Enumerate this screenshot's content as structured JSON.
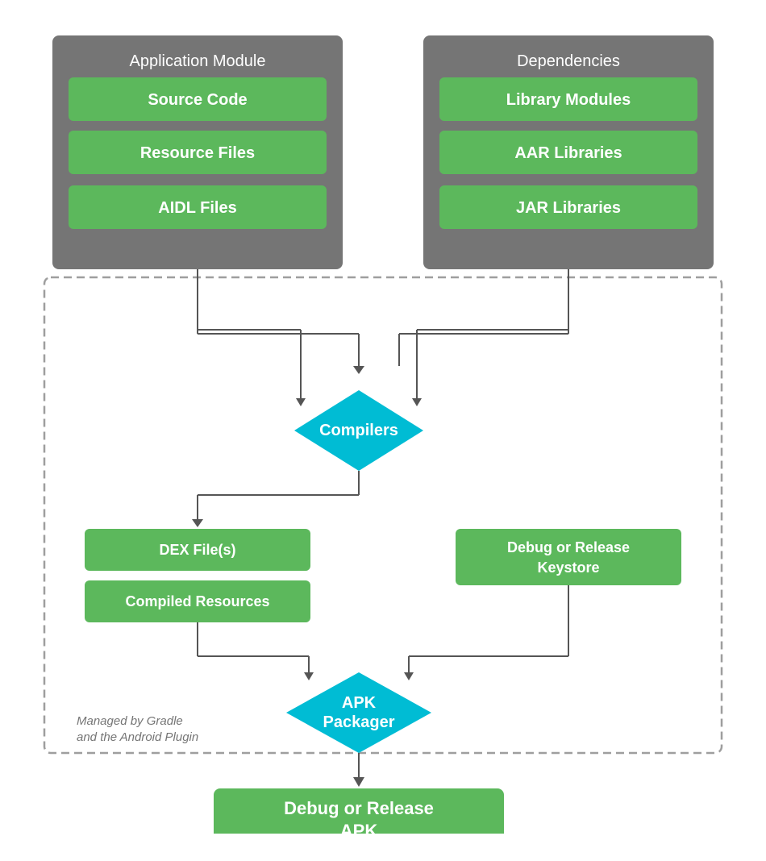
{
  "diagram": {
    "appModule": {
      "title": "Application Module",
      "items": [
        "Source Code",
        "Resource Files",
        "AIDL Files"
      ]
    },
    "dependencies": {
      "title": "Dependencies",
      "items": [
        "Library Modules",
        "AAR Libraries",
        "JAR Libraries"
      ]
    },
    "compilers": {
      "label": "Compilers"
    },
    "dexFiles": "DEX File(s)",
    "compiledResources": "Compiled Resources",
    "debugKeystore": "Debug or Release\nKeystore",
    "apkPackager": {
      "label": "APK\nPackager"
    },
    "managedLabel": "Managed by Gradle\nand the Android Plugin",
    "outputApk": "Debug or Release\nAPK"
  }
}
